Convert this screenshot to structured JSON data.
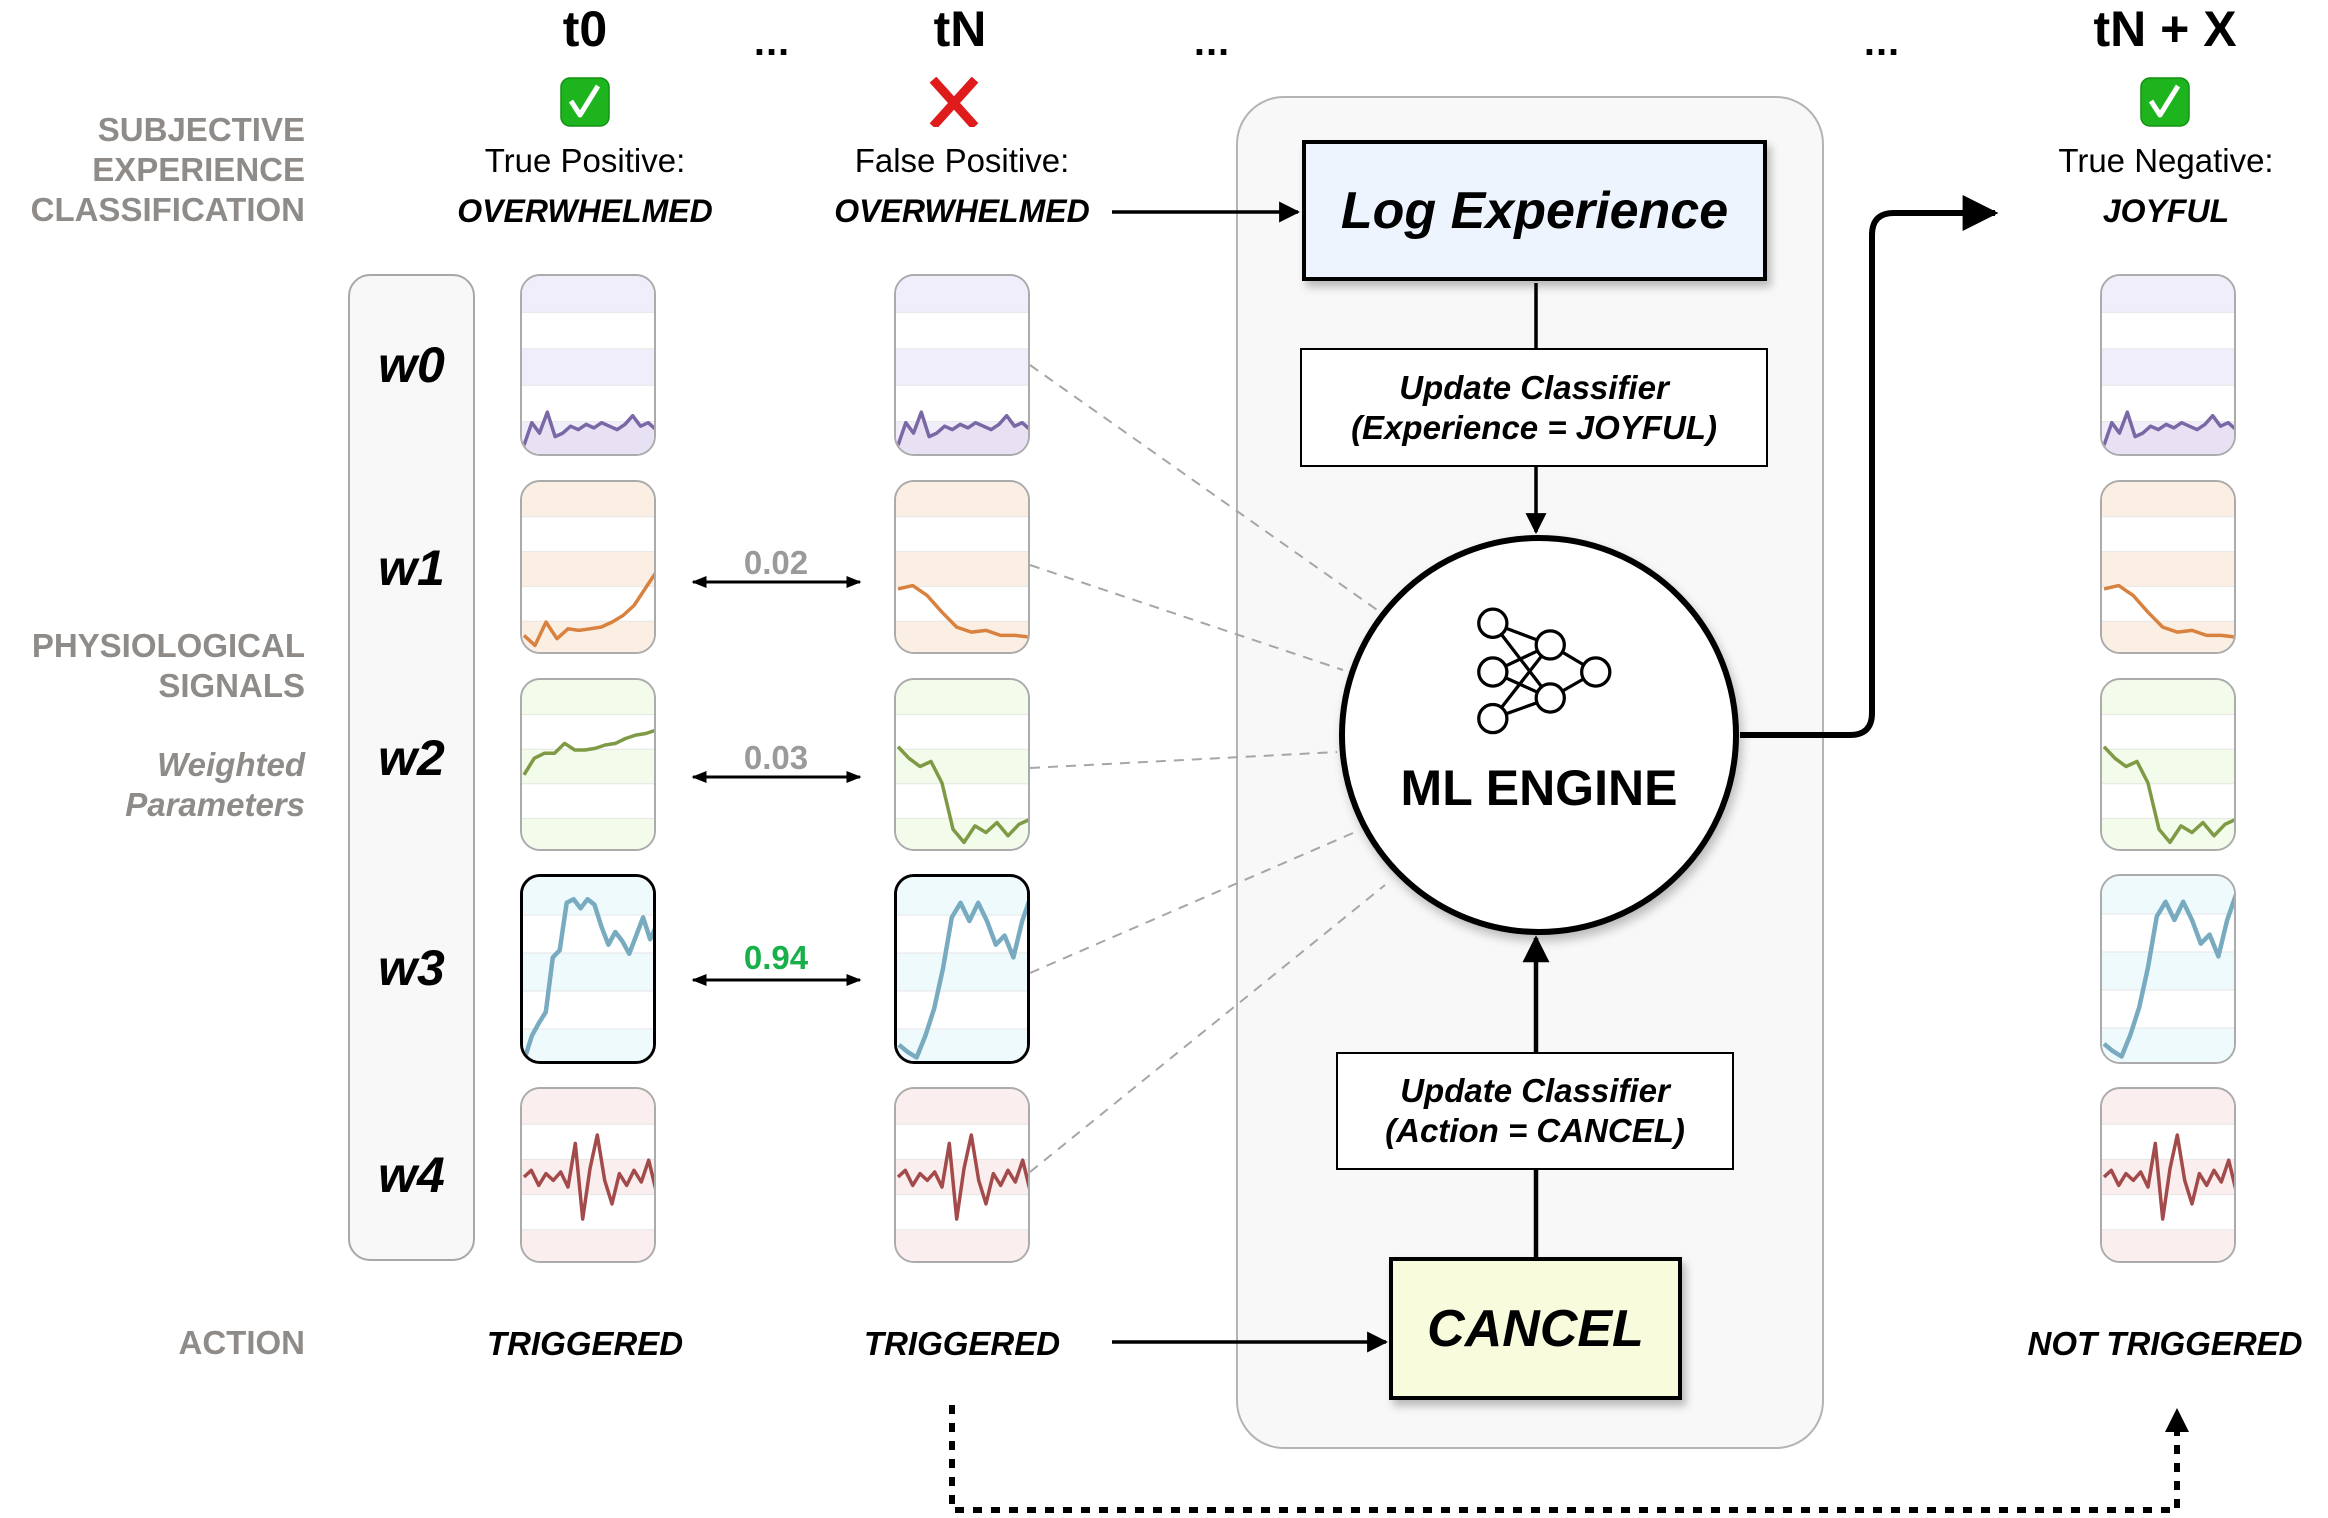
{
  "columns": [
    {
      "id": "t0",
      "title": "t0",
      "status_icon": "check-icon",
      "classification_label": "True Positive:",
      "classification_value": "OVERWHELMED",
      "action": "TRIGGERED"
    },
    {
      "id": "tN",
      "title": "tN",
      "status_icon": "cross-icon",
      "classification_label": "False Positive:",
      "classification_value": "OVERWHELMED",
      "action": "TRIGGERED"
    },
    {
      "id": "tNX",
      "title": "tN + X",
      "status_icon": "check-icon",
      "classification_label": "True Negative:",
      "classification_value": "JOYFUL",
      "action": "NOT TRIGGERED"
    }
  ],
  "ellipsis": [
    "...",
    "...",
    "..."
  ],
  "side_labels": {
    "classification": [
      "SUBJECTIVE",
      "EXPERIENCE",
      "CLASSIFICATION"
    ],
    "signals": [
      "PHYSIOLOGICAL",
      "SIGNALS"
    ],
    "weighted": [
      "Weighted",
      "Parameters"
    ],
    "action": "ACTION"
  },
  "weights": [
    {
      "label": "w0",
      "similarity": null
    },
    {
      "label": "w1",
      "similarity": "0.02"
    },
    {
      "label": "w2",
      "similarity": "0.03"
    },
    {
      "label": "w3",
      "similarity": "0.94",
      "highlight": true
    },
    {
      "label": "w4",
      "similarity": null
    }
  ],
  "signal_colors": [
    {
      "line": "#7a68a6",
      "band": "#f1eefb",
      "fill": "#e2dcef"
    },
    {
      "line": "#d9813e",
      "band": "#fbefe4"
    },
    {
      "line": "#7e9a45",
      "band": "#f3fbea"
    },
    {
      "line": "#78abc0",
      "band": "#effafd"
    },
    {
      "line": "#a34a4a",
      "band": "#fbeeee"
    }
  ],
  "signal_series": {
    "t0": [
      [
        0.95,
        0.82,
        0.88,
        0.76,
        0.9,
        0.88,
        0.84,
        0.86,
        0.83,
        0.85,
        0.82,
        0.84,
        0.86,
        0.83,
        0.78,
        0.84,
        0.82,
        0.86
      ],
      [
        0.9,
        0.96,
        0.82,
        0.92,
        0.86,
        0.87,
        0.86,
        0.85,
        0.82,
        0.78,
        0.72,
        0.62,
        0.52
      ],
      [
        0.55,
        0.45,
        0.42,
        0.42,
        0.36,
        0.4,
        0.4,
        0.39,
        0.37,
        0.36,
        0.33,
        0.31,
        0.3,
        0.28
      ],
      [
        0.97,
        0.85,
        0.78,
        0.72,
        0.42,
        0.38,
        0.12,
        0.1,
        0.15,
        0.1,
        0.13,
        0.25,
        0.35,
        0.28,
        0.33,
        0.4,
        0.3,
        0.2,
        0.32,
        0.24
      ],
      [
        0.5,
        0.46,
        0.55,
        0.48,
        0.52,
        0.47,
        0.56,
        0.3,
        0.75,
        0.45,
        0.25,
        0.52,
        0.66,
        0.48,
        0.55,
        0.46,
        0.53,
        0.4,
        0.58
      ]
    ],
    "tN": [
      [
        0.95,
        0.82,
        0.88,
        0.76,
        0.9,
        0.88,
        0.84,
        0.86,
        0.83,
        0.85,
        0.82,
        0.84,
        0.86,
        0.83,
        0.78,
        0.84,
        0.82,
        0.86
      ],
      [
        0.62,
        0.6,
        0.66,
        0.76,
        0.85,
        0.88,
        0.87,
        0.9,
        0.9,
        0.91
      ],
      [
        0.38,
        0.45,
        0.5,
        0.47,
        0.6,
        0.88,
        0.96,
        0.86,
        0.9,
        0.84,
        0.92,
        0.85,
        0.82
      ],
      [
        0.9,
        0.94,
        0.97,
        0.85,
        0.7,
        0.48,
        0.2,
        0.12,
        0.22,
        0.12,
        0.22,
        0.35,
        0.3,
        0.42,
        0.22,
        0.08
      ],
      [
        0.5,
        0.46,
        0.55,
        0.48,
        0.52,
        0.47,
        0.56,
        0.3,
        0.75,
        0.45,
        0.25,
        0.52,
        0.66,
        0.48,
        0.55,
        0.46,
        0.53,
        0.4,
        0.58
      ]
    ],
    "tNX": [
      [
        0.95,
        0.82,
        0.88,
        0.76,
        0.9,
        0.88,
        0.84,
        0.86,
        0.83,
        0.85,
        0.82,
        0.84,
        0.86,
        0.83,
        0.78,
        0.84,
        0.82,
        0.86
      ],
      [
        0.62,
        0.6,
        0.66,
        0.76,
        0.85,
        0.88,
        0.87,
        0.9,
        0.9,
        0.91
      ],
      [
        0.38,
        0.45,
        0.5,
        0.47,
        0.6,
        0.88,
        0.96,
        0.86,
        0.9,
        0.84,
        0.92,
        0.85,
        0.82
      ],
      [
        0.9,
        0.94,
        0.97,
        0.85,
        0.7,
        0.48,
        0.2,
        0.12,
        0.22,
        0.12,
        0.22,
        0.35,
        0.3,
        0.42,
        0.22,
        0.08
      ],
      [
        0.5,
        0.46,
        0.55,
        0.48,
        0.52,
        0.47,
        0.56,
        0.3,
        0.75,
        0.45,
        0.25,
        0.52,
        0.66,
        0.48,
        0.55,
        0.46,
        0.53,
        0.4,
        0.58
      ]
    ]
  },
  "engine": {
    "log_box": "Log Experience",
    "update_experience": [
      "Update Classifier",
      "(Experience = JOYFUL)"
    ],
    "engine_label": "ML ENGINE",
    "engine_icon": "neural-network-icon",
    "update_action": [
      "Update Classifier",
      "(Action = CANCEL)"
    ],
    "cancel_box": "CANCEL"
  },
  "colors": {
    "similarity_low": "#9a9a9a",
    "similarity_high": "#19b04b",
    "check_green": "#1db41d",
    "cross_red": "#e01b1b",
    "log_box_bg": "#eef4fe",
    "cancel_box_bg": "#f8fcdc",
    "side_label_gray": "#8f8b88"
  }
}
